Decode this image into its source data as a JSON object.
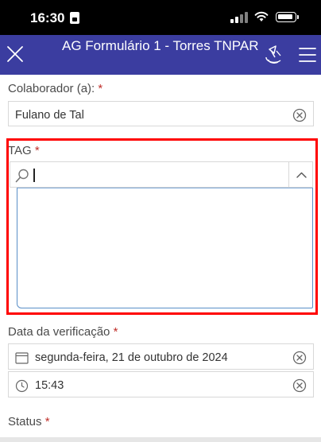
{
  "status_bar": {
    "time": "16:30"
  },
  "header": {
    "title": "AG Formulário 1 - Torres TNPAR",
    "bg_color": "#3b3da0"
  },
  "form": {
    "colaborador": {
      "label": "Colaborador (a): ",
      "required_mark": "*",
      "value": "Fulano de Tal"
    },
    "tag": {
      "label": "TAG ",
      "required_mark": "*",
      "search_value": "",
      "highlight_color": "#ff0000"
    },
    "data_verificacao": {
      "label": "Data da verificação ",
      "required_mark": "*",
      "date_value": "segunda-feira, 21 de outubro de 2024",
      "time_value": "15:43"
    },
    "status": {
      "label": "Status ",
      "required_mark": "*"
    }
  },
  "icons": {
    "close": "close-icon",
    "gps": "gps-icon",
    "menu": "hamburger-menu-icon",
    "clear": "clear-circle-x-icon",
    "search": "search-icon",
    "collapse": "chevron-up-icon",
    "calendar": "calendar-icon",
    "clock": "clock-icon"
  }
}
